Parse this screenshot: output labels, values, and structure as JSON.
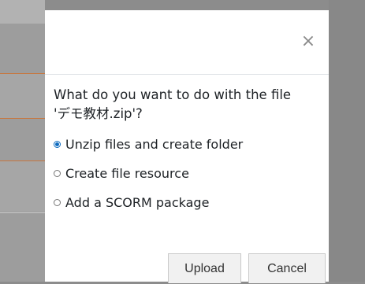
{
  "dialog": {
    "close_symbol": "×",
    "question_line1": "What do you want to do with the file",
    "question_line2": "'デモ教材.zip'?",
    "options": [
      {
        "label": "Unzip files and create folder",
        "selected": true
      },
      {
        "label": "Create file resource",
        "selected": false
      },
      {
        "label": "Add a SCORM package",
        "selected": false
      }
    ],
    "buttons": {
      "upload": "Upload",
      "cancel": "Cancel"
    }
  },
  "colors": {
    "accent": "#0f6cbf",
    "orange_line": "#c7773f"
  }
}
